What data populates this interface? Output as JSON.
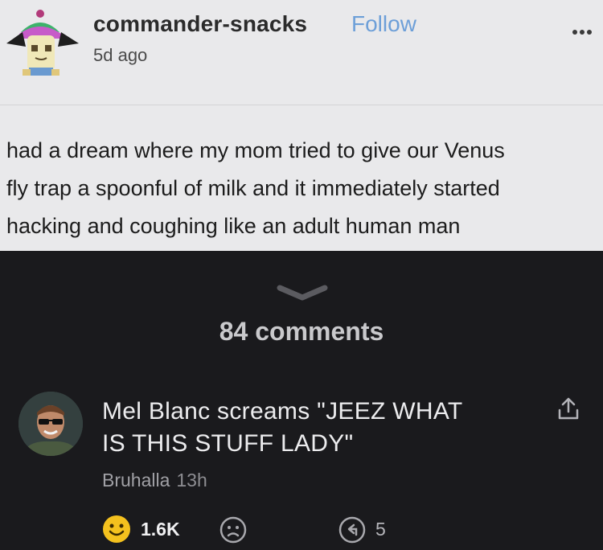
{
  "post": {
    "username": "commander-snacks",
    "follow_label": "Follow",
    "time_ago": "5d ago",
    "text_lines": [
      "had a dream where my mom tried to give our Venus",
      "fly trap a spoonful of milk and it immediately started",
      "hacking and coughing like an adult human man"
    ]
  },
  "comments": {
    "count_label": "84 comments",
    "top_comment": {
      "text_lines": [
        "Mel Blanc screams \"JEEZ WHAT",
        "IS THIS STUFF LADY\""
      ],
      "author": "Bruhalla",
      "time": "13h",
      "reactions": {
        "smile_count": "1.6K",
        "replies_count": "5"
      }
    }
  },
  "colors": {
    "post_bg": "#e9e9eb",
    "dark_bg": "#1a1a1d",
    "follow": "#6d9fd8",
    "smile": "#f4c11e"
  },
  "icons": [
    "avatar",
    "more-options-icon",
    "chevron-down-icon",
    "share-icon",
    "smile-reaction-icon",
    "frown-reaction-icon",
    "reply-icon"
  ]
}
